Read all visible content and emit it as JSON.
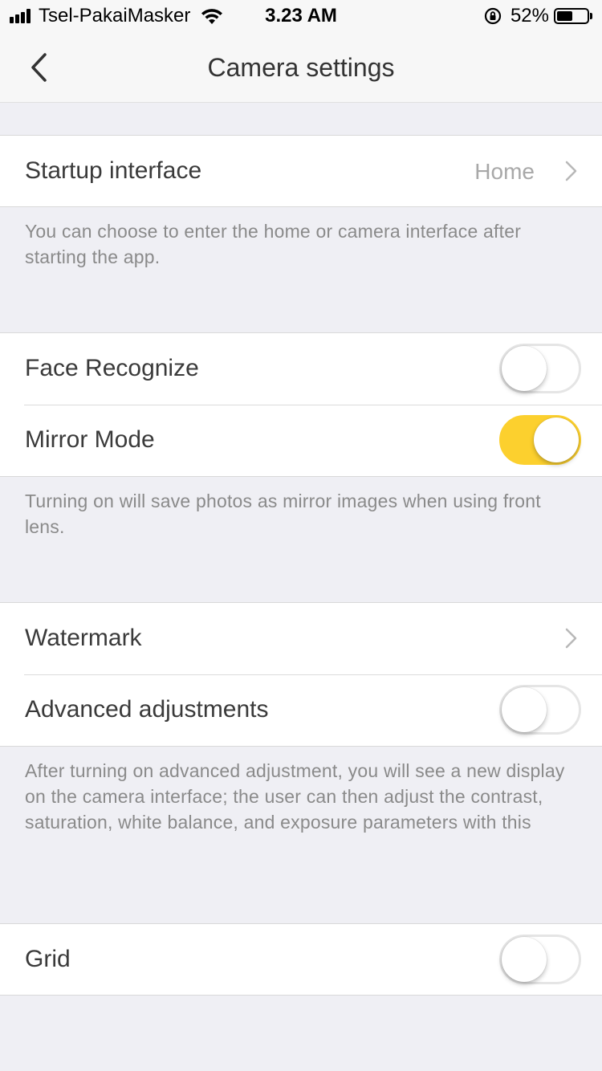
{
  "status_bar": {
    "carrier": "Tsel-PakaiMasker",
    "time": "3.23 AM",
    "battery_percent": "52%",
    "battery_level": 0.52,
    "signal_bars": 4
  },
  "nav": {
    "title": "Camera settings",
    "back_icon": "chevron-left-icon"
  },
  "sections": {
    "startup": {
      "label": "Startup interface",
      "value": "Home",
      "note": "You can choose to enter the home or camera interface after starting the app."
    },
    "face_recognize": {
      "label": "Face Recognize",
      "enabled": false
    },
    "mirror_mode": {
      "label": "Mirror Mode",
      "enabled": true,
      "note": "Turning on will save photos as mirror images when using front lens."
    },
    "watermark": {
      "label": "Watermark"
    },
    "advanced": {
      "label": "Advanced adjustments",
      "enabled": false,
      "note": "After turning on advanced adjustment, you will see a new display on the camera interface; the user can then adjust the contrast, saturation, white balance, and exposure parameters with this"
    },
    "grid": {
      "label": "Grid",
      "enabled": false
    }
  },
  "colors": {
    "accent": "#fcd02e",
    "background": "#efeff4",
    "note_text": "#8a8a8a"
  }
}
